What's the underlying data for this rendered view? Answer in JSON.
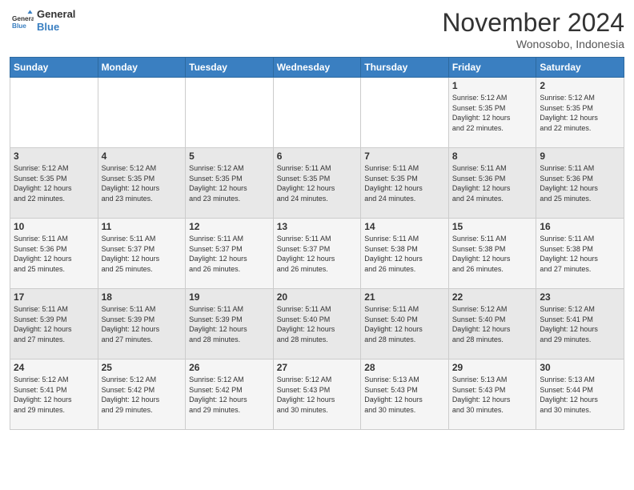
{
  "logo": {
    "line1": "General",
    "line2": "Blue"
  },
  "header": {
    "month": "November 2024",
    "location": "Wonosobo, Indonesia"
  },
  "weekdays": [
    "Sunday",
    "Monday",
    "Tuesday",
    "Wednesday",
    "Thursday",
    "Friday",
    "Saturday"
  ],
  "weeks": [
    [
      {
        "day": "",
        "info": ""
      },
      {
        "day": "",
        "info": ""
      },
      {
        "day": "",
        "info": ""
      },
      {
        "day": "",
        "info": ""
      },
      {
        "day": "",
        "info": ""
      },
      {
        "day": "1",
        "info": "Sunrise: 5:12 AM\nSunset: 5:35 PM\nDaylight: 12 hours\nand 22 minutes."
      },
      {
        "day": "2",
        "info": "Sunrise: 5:12 AM\nSunset: 5:35 PM\nDaylight: 12 hours\nand 22 minutes."
      }
    ],
    [
      {
        "day": "3",
        "info": "Sunrise: 5:12 AM\nSunset: 5:35 PM\nDaylight: 12 hours\nand 22 minutes."
      },
      {
        "day": "4",
        "info": "Sunrise: 5:12 AM\nSunset: 5:35 PM\nDaylight: 12 hours\nand 23 minutes."
      },
      {
        "day": "5",
        "info": "Sunrise: 5:12 AM\nSunset: 5:35 PM\nDaylight: 12 hours\nand 23 minutes."
      },
      {
        "day": "6",
        "info": "Sunrise: 5:11 AM\nSunset: 5:35 PM\nDaylight: 12 hours\nand 24 minutes."
      },
      {
        "day": "7",
        "info": "Sunrise: 5:11 AM\nSunset: 5:35 PM\nDaylight: 12 hours\nand 24 minutes."
      },
      {
        "day": "8",
        "info": "Sunrise: 5:11 AM\nSunset: 5:36 PM\nDaylight: 12 hours\nand 24 minutes."
      },
      {
        "day": "9",
        "info": "Sunrise: 5:11 AM\nSunset: 5:36 PM\nDaylight: 12 hours\nand 25 minutes."
      }
    ],
    [
      {
        "day": "10",
        "info": "Sunrise: 5:11 AM\nSunset: 5:36 PM\nDaylight: 12 hours\nand 25 minutes."
      },
      {
        "day": "11",
        "info": "Sunrise: 5:11 AM\nSunset: 5:37 PM\nDaylight: 12 hours\nand 25 minutes."
      },
      {
        "day": "12",
        "info": "Sunrise: 5:11 AM\nSunset: 5:37 PM\nDaylight: 12 hours\nand 26 minutes."
      },
      {
        "day": "13",
        "info": "Sunrise: 5:11 AM\nSunset: 5:37 PM\nDaylight: 12 hours\nand 26 minutes."
      },
      {
        "day": "14",
        "info": "Sunrise: 5:11 AM\nSunset: 5:38 PM\nDaylight: 12 hours\nand 26 minutes."
      },
      {
        "day": "15",
        "info": "Sunrise: 5:11 AM\nSunset: 5:38 PM\nDaylight: 12 hours\nand 26 minutes."
      },
      {
        "day": "16",
        "info": "Sunrise: 5:11 AM\nSunset: 5:38 PM\nDaylight: 12 hours\nand 27 minutes."
      }
    ],
    [
      {
        "day": "17",
        "info": "Sunrise: 5:11 AM\nSunset: 5:39 PM\nDaylight: 12 hours\nand 27 minutes."
      },
      {
        "day": "18",
        "info": "Sunrise: 5:11 AM\nSunset: 5:39 PM\nDaylight: 12 hours\nand 27 minutes."
      },
      {
        "day": "19",
        "info": "Sunrise: 5:11 AM\nSunset: 5:39 PM\nDaylight: 12 hours\nand 28 minutes."
      },
      {
        "day": "20",
        "info": "Sunrise: 5:11 AM\nSunset: 5:40 PM\nDaylight: 12 hours\nand 28 minutes."
      },
      {
        "day": "21",
        "info": "Sunrise: 5:11 AM\nSunset: 5:40 PM\nDaylight: 12 hours\nand 28 minutes."
      },
      {
        "day": "22",
        "info": "Sunrise: 5:12 AM\nSunset: 5:40 PM\nDaylight: 12 hours\nand 28 minutes."
      },
      {
        "day": "23",
        "info": "Sunrise: 5:12 AM\nSunset: 5:41 PM\nDaylight: 12 hours\nand 29 minutes."
      }
    ],
    [
      {
        "day": "24",
        "info": "Sunrise: 5:12 AM\nSunset: 5:41 PM\nDaylight: 12 hours\nand 29 minutes."
      },
      {
        "day": "25",
        "info": "Sunrise: 5:12 AM\nSunset: 5:42 PM\nDaylight: 12 hours\nand 29 minutes."
      },
      {
        "day": "26",
        "info": "Sunrise: 5:12 AM\nSunset: 5:42 PM\nDaylight: 12 hours\nand 29 minutes."
      },
      {
        "day": "27",
        "info": "Sunrise: 5:12 AM\nSunset: 5:43 PM\nDaylight: 12 hours\nand 30 minutes."
      },
      {
        "day": "28",
        "info": "Sunrise: 5:13 AM\nSunset: 5:43 PM\nDaylight: 12 hours\nand 30 minutes."
      },
      {
        "day": "29",
        "info": "Sunrise: 5:13 AM\nSunset: 5:43 PM\nDaylight: 12 hours\nand 30 minutes."
      },
      {
        "day": "30",
        "info": "Sunrise: 5:13 AM\nSunset: 5:44 PM\nDaylight: 12 hours\nand 30 minutes."
      }
    ]
  ]
}
